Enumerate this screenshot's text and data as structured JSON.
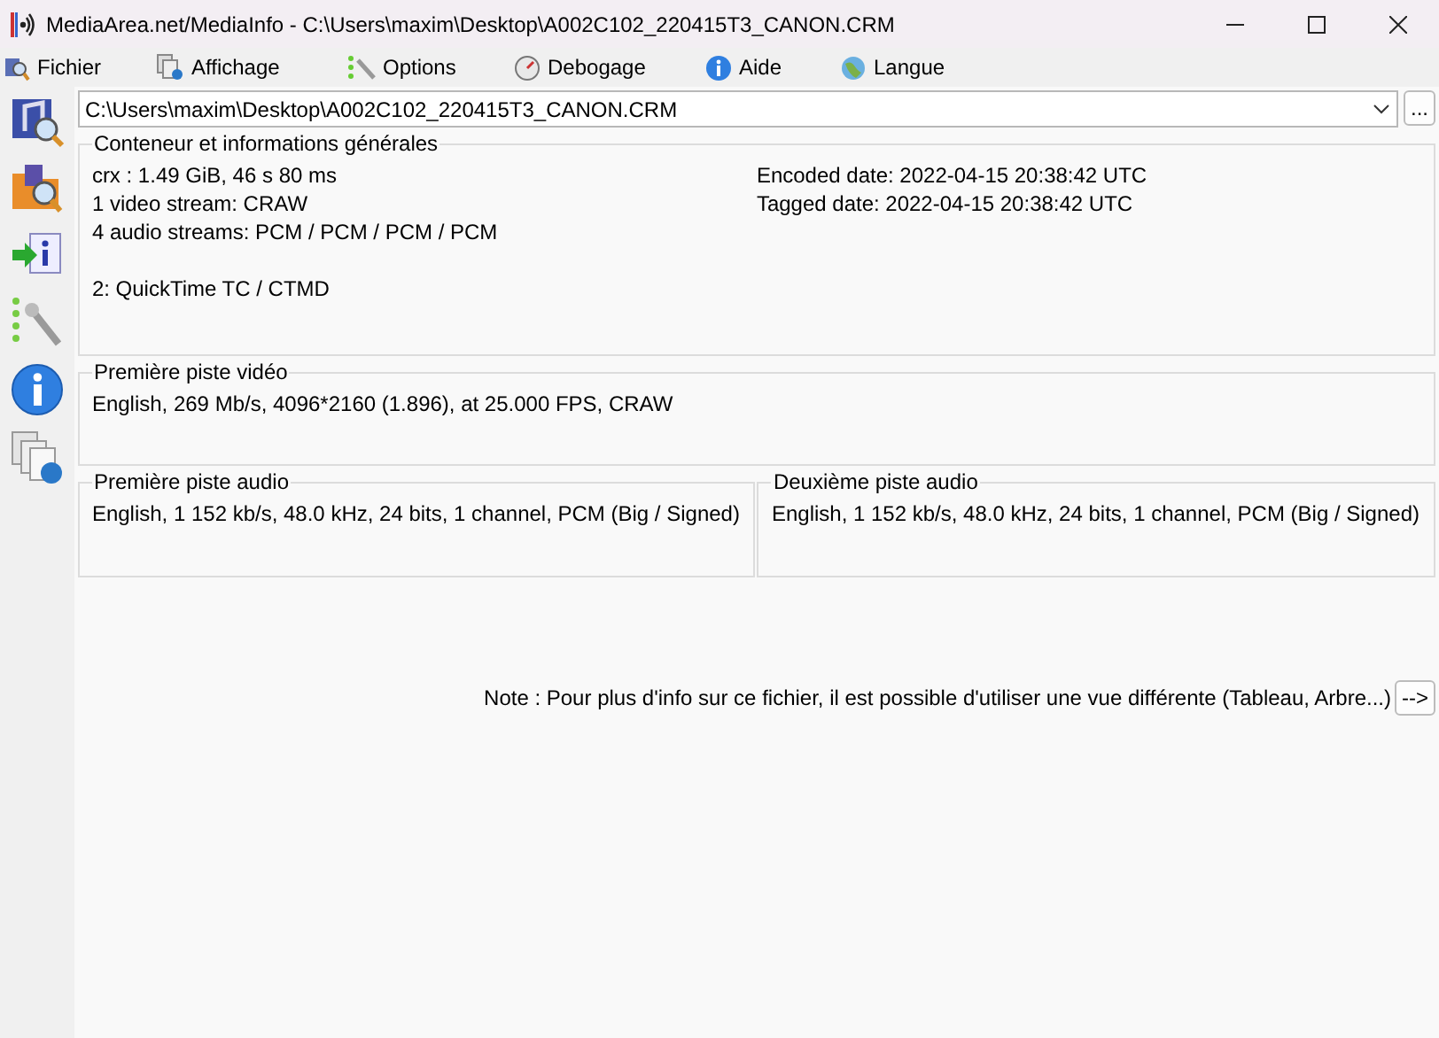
{
  "window": {
    "title": "MediaArea.net/MediaInfo - C:\\Users\\maxim\\Desktop\\A002C102_220415T3_CANON.CRM"
  },
  "menu": [
    "Fichier",
    "Affichage",
    "Options",
    "Debogage",
    "Aide",
    "Langue"
  ],
  "file_path": "C:\\Users\\maxim\\Desktop\\A002C102_220415T3_CANON.CRM",
  "browse_button": "...",
  "general": {
    "title": "Conteneur et informations générales",
    "left_groups": [
      [
        "crx : 1.49 GiB, 46 s 80 ms",
        "1 video stream: CRAW",
        "4 audio streams: PCM / PCM / PCM / PCM"
      ],
      [
        "2: QuickTime TC / CTMD"
      ]
    ],
    "right_lines": [
      "Encoded date: 2022-04-15 20:38:42 UTC",
      "Tagged date: 2022-04-15 20:38:42 UTC"
    ]
  },
  "video": {
    "title": "Première piste vidéo",
    "lines": [
      "English, 269 Mb/s, 4096*2160 (1.896), at 25.000 FPS, CRAW"
    ]
  },
  "audio": [
    {
      "title": "Première piste audio",
      "lines": [
        "English, 1 152 kb/s, 48.0 kHz, 24 bits, 1 channel, PCM (Big / Signed)"
      ]
    },
    {
      "title": "Deuxième piste audio",
      "lines": [
        "English, 1 152 kb/s, 48.0 kHz, 24 bits, 1 channel, PCM (Big / Signed)"
      ]
    }
  ],
  "note": "Note : Pour plus d'info sur ce fichier, il est possible d'utiliser une vue différente (Tableau, Arbre...)",
  "next_button": "-->"
}
